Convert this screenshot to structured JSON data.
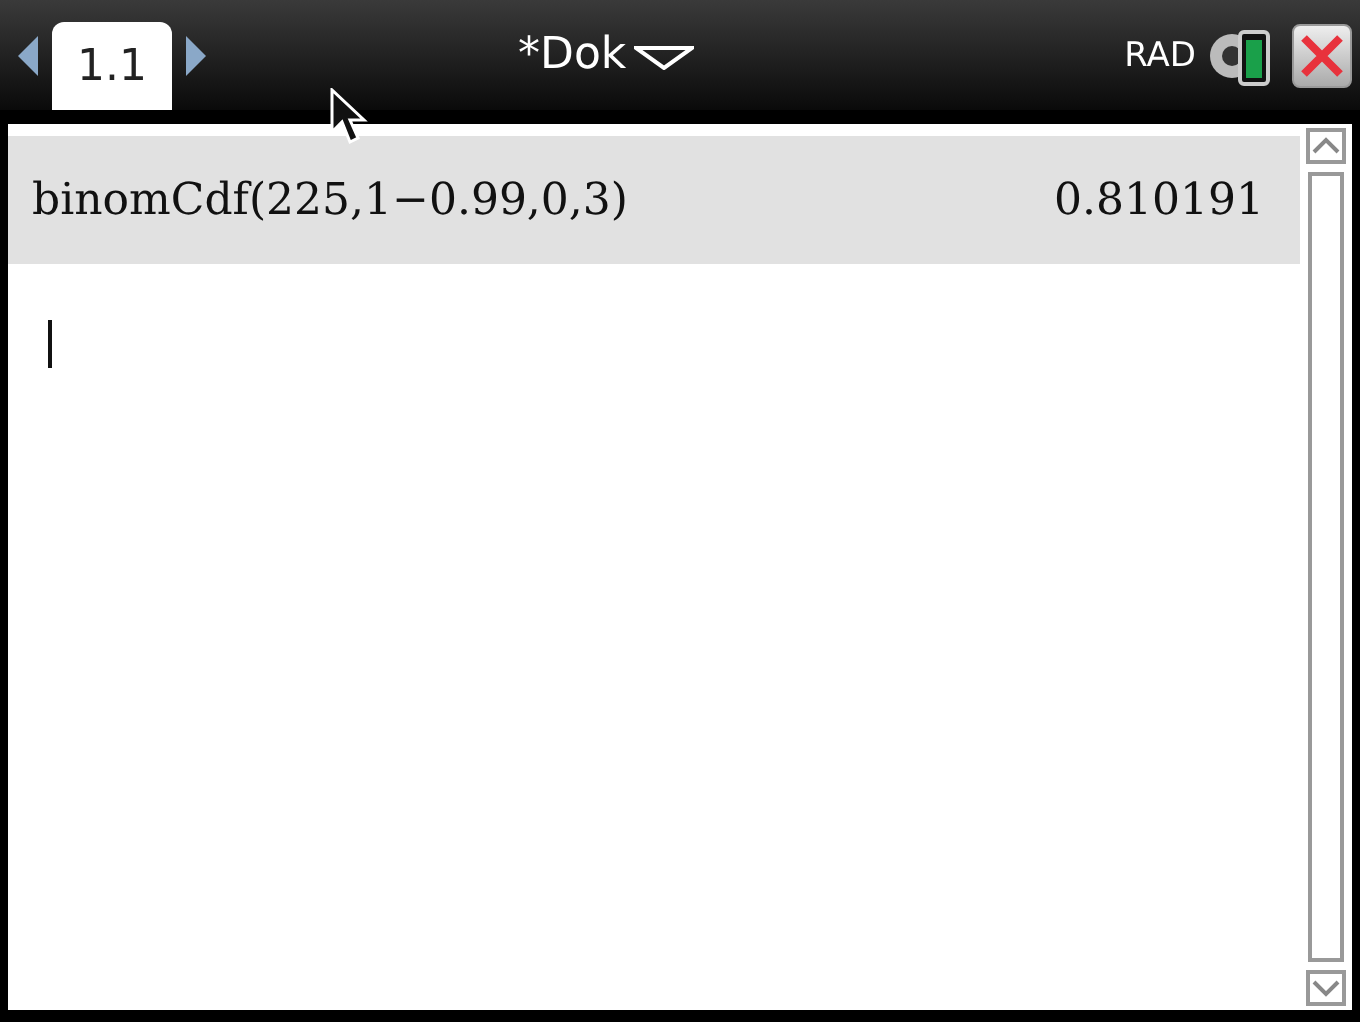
{
  "tabs": [
    {
      "label": "1.1",
      "selected": true
    }
  ],
  "document": {
    "title": "*Dok"
  },
  "mode": "RAD",
  "history": [
    {
      "input": "binomCdf(225,1−0.99,0,3)",
      "result": "0.810191"
    }
  ]
}
